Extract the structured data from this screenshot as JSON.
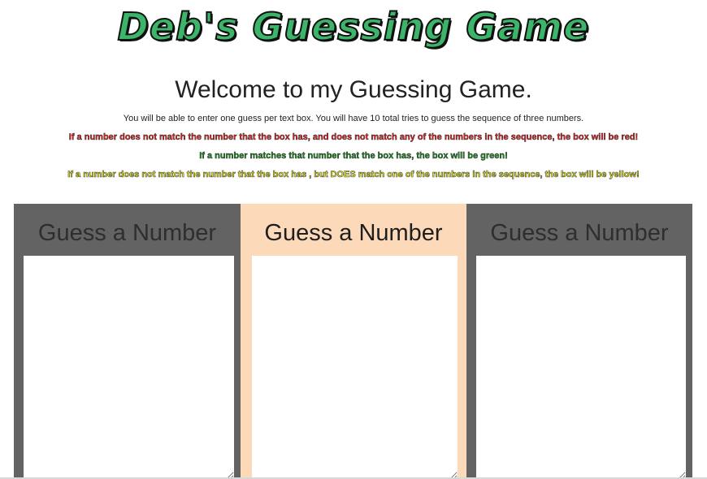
{
  "header": {
    "logo_text": "Deb's Guessing Game",
    "welcome": "Welcome to my Guessing Game.",
    "info": "You will be able to enter one guess per text box. You will have 10 total tries to guess the sequence of three numbers."
  },
  "rules": {
    "red": "If a number does not match the number that the box has, and does not match any of the numbers in the sequence, the box will be red!",
    "green": "If a number matches that number that the box has, the box will be green!",
    "yellow": "If a number does not match the number that the box has , but DOES match one of the numbers in the sequence, the box will be yellow!"
  },
  "columns": [
    {
      "title": "Guess a Number",
      "value": ""
    },
    {
      "title": "Guess a Number",
      "value": ""
    },
    {
      "title": "Guess a Number",
      "value": ""
    }
  ],
  "colors": {
    "logo_green": "#3cb46a",
    "panel_gray": "#636363",
    "panel_peach": "#fcd9b9",
    "rule_red": "#e02020",
    "rule_green": "#1a8a1a",
    "rule_yellow": "#f5f500"
  }
}
